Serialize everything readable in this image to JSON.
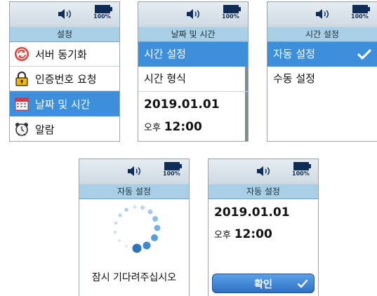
{
  "status": {
    "volume_icon": "speaker-icon",
    "battery_icon": "battery-icon",
    "battery_text": "100%"
  },
  "screens": [
    {
      "title": "설정",
      "items": [
        {
          "label": "서버 동기화",
          "icon": "sync-icon"
        },
        {
          "label": "인증번호 요청",
          "icon": "lock-icon"
        },
        {
          "label": "날짜 및 시간",
          "icon": "calendar-icon",
          "selected": true
        },
        {
          "label": "알람",
          "icon": "alarm-clock-icon"
        }
      ]
    },
    {
      "title": "날짜 및 시간",
      "items": [
        {
          "label": "시간 설정",
          "selected": true
        },
        {
          "label": "시간 형식"
        }
      ],
      "date": "2019.01.01",
      "ampm": "오후",
      "time": "12:00"
    },
    {
      "title": "시간 설정",
      "items": [
        {
          "label": "자동 설정",
          "selected": true,
          "icon": "check-icon"
        },
        {
          "label": "수동 설정"
        }
      ]
    },
    {
      "title": "자동 설정",
      "spinner_icon": "loading-spinner-icon",
      "message": "잠시 기다려주십시오"
    },
    {
      "title": "자동 설정",
      "date": "2019.01.01",
      "ampm": "오후",
      "time": "12:00",
      "button_label": "확인",
      "button_icon": "check-icon"
    }
  ],
  "colors": {
    "accent": "#3d8fdc",
    "title_bar": "#a9cfe6",
    "status_bar": "#dde6ec",
    "battery": "#0f2c57"
  }
}
